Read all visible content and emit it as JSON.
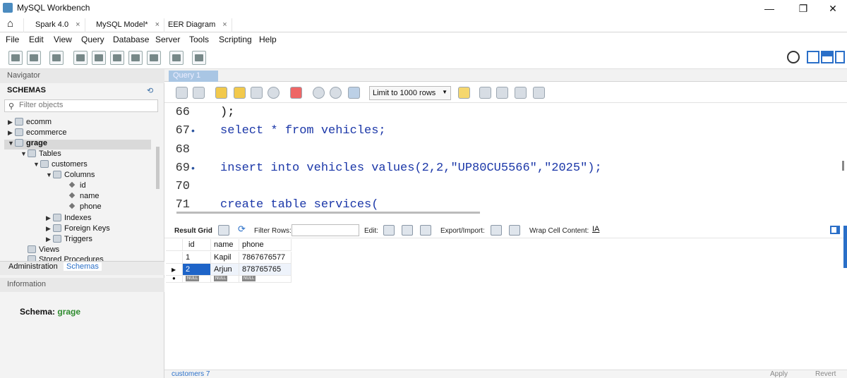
{
  "window": {
    "title": "MySQL Workbench",
    "minimize": "—",
    "maximize": "❐",
    "close": "✕"
  },
  "tabs": [
    {
      "label": "Spark 4.0",
      "close": "×"
    },
    {
      "label": "MySQL Model*",
      "close": "×"
    },
    {
      "label": "EER Diagram",
      "close": "×"
    }
  ],
  "menu": [
    "File",
    "Edit",
    "View",
    "Query",
    "Database",
    "Server",
    "Tools",
    "Scripting",
    "Help"
  ],
  "navigator": {
    "title": "Navigator",
    "schemas_heading": "SCHEMAS",
    "filter_placeholder": "Filter objects",
    "tree": {
      "ecomm": "ecomm",
      "ecommerce": "ecommerce",
      "grage": "grage",
      "tables": "Tables",
      "customers": "customers",
      "columns": "Columns",
      "col_id": "id",
      "col_name": "name",
      "col_phone": "phone",
      "indexes": "Indexes",
      "foreign_keys": "Foreign Keys",
      "triggers": "Triggers",
      "views": "Views",
      "stored_procedures": "Stored Procedures"
    },
    "tab_administration": "Administration",
    "tab_schemas": "Schemas",
    "information_heading": "Information",
    "schema_label": "Schema:",
    "schema_value": "grage"
  },
  "query": {
    "tab_label": "Query 1",
    "limit_label": "Limit to 1000 rows",
    "lines": [
      {
        "num": "66",
        "dot": "",
        "code": ");"
      },
      {
        "num": "67",
        "dot": "•",
        "code": "select * from vehicles;"
      },
      {
        "num": "68",
        "dot": "",
        "code": ""
      },
      {
        "num": "69",
        "dot": "•",
        "code": "insert into vehicles values(2,2,\"UP80CU5566\",\"2025\");"
      },
      {
        "num": "70",
        "dot": "",
        "code": ""
      },
      {
        "num": "71",
        "dot": "",
        "code": "create table services("
      }
    ]
  },
  "result": {
    "result_grid": "Result Grid",
    "filter_rows": "Filter Rows:",
    "edit": "Edit:",
    "export_import": "Export/Import:",
    "wrap_cell": "Wrap Cell Content:",
    "columns": [
      "id",
      "name",
      "phone"
    ],
    "rows": [
      [
        "1",
        "Kapil",
        "7867676577"
      ],
      [
        "2",
        "Arjun",
        "878765765"
      ]
    ],
    "null_label": "NULL"
  },
  "bottom": {
    "tab": "customers 7",
    "apply": "Apply",
    "revert": "Revert"
  }
}
